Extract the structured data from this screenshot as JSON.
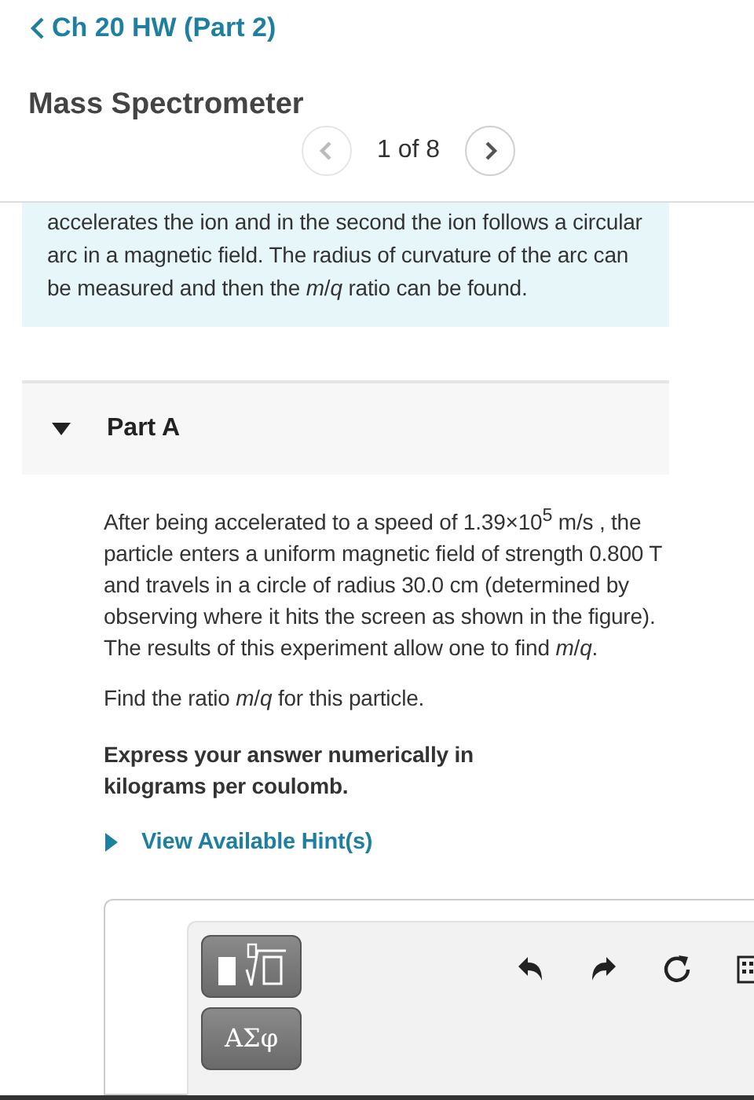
{
  "header": {
    "back_link": "Ch 20 HW (Part 2)",
    "title": "Mass Spectrometer"
  },
  "pager": {
    "label": "1 of 8",
    "prev_disabled": true,
    "next_disabled": false
  },
  "intro": {
    "text": "accelerates the ion and in the second the ion follows a circular arc in a magnetic field. The radius of curvature of the arc can be measured and then the *m*/*q* ratio can be found."
  },
  "part": {
    "title": "Part A",
    "expanded": true,
    "problem": "After being accelerated to a speed of 1.39×10$^{5}$ m/s , the particle enters a uniform magnetic field of strength 0.800 T and travels in a circle of radius 30.0 cm (determined by observing where it hits the screen as shown in the figure). The results of this experiment allow one to find *m*/*q*.",
    "question": "Find the ratio *m*/*q* for this particle.",
    "instruction": "Express your answer numerically in kilograms per coulomb.",
    "hint": {
      "label": "View Available Hint(s)",
      "expanded": false
    },
    "toolbar": {
      "symbols_button": "ΑΣφ"
    }
  }
}
